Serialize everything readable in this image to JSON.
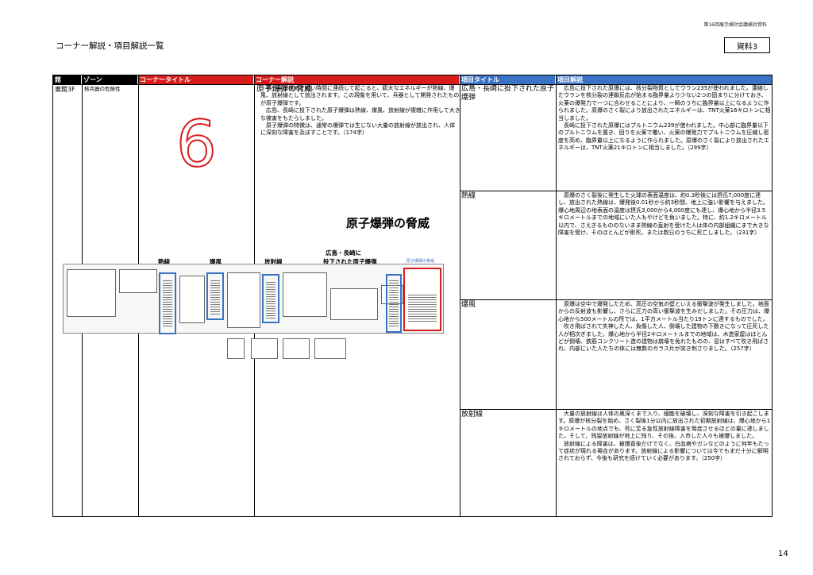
{
  "header": {
    "note": "第16回展示検討会議検討資料",
    "title": "コーナー解説・項目解説一覧",
    "badge": "資料3",
    "page_number": "14"
  },
  "colors": {
    "black": "#000000",
    "red": "#d81b1b",
    "blue": "#3a72c4"
  },
  "columns": [
    "館",
    "ゾーン",
    "コーナータイトル",
    "コーナー解説",
    "項目タイトル",
    "項目解説"
  ],
  "row": {
    "building": "東館3F",
    "zone": "核兵器の危険性",
    "corner_title": "原子爆弾の脅威",
    "corner_number": "6",
    "corner_text": "　核分裂が極めて短い時間に連続して起こると、膨大なエネルギーが熱線、爆風、放射線として放出されます。この現象を用いて、兵器として開発されたものが原子爆弾です。\n　広島、長崎に投下された原子爆弾は熱線、爆風、放射線が複雑に作用して大きな被害をもたらしました。\n　原子爆弾の特徴は、通常の爆弾では生じない大量の放射線が放出され、人体に深刻な障害を及ぼすことです。（174字）"
  },
  "items": [
    {
      "title": "広島・長崎に投下された原子爆弾",
      "text": "　広島に投下された原爆には、核分裂物質としてウラン235が使われました。濃縮したウランを核分裂の連鎖反応が始まる臨界量より少ない2つの固まりに分けておき、火薬の爆発力で一つに合わせることにより、一瞬のうちに臨界量以上になるように作られました。原爆のさく裂により放出されたエネルギーは、TNT火薬16キロトンに相当しました。\n　長崎に投下された原爆にはプルトニウム239が使われました。中心部に臨界量以下のプルトニウムを置き、回りを火薬で覆い、火薬の爆発力でプルトニウムを圧縮し密度を高め、臨界量以上になるように作られました。原爆のさく裂により放出されたエネルギーは、TNT火薬21キロトンに相当しました。（299字）"
    },
    {
      "title": "熱線",
      "text": "　原爆のさく裂後に発生した火球の表面温度は、約0.3秒後には摂氏7,000度に達し、放出された熱線は、爆発後0.01秒から約3秒間、地上に強い影響を与えました。爆心地周辺の地表面の温度は摂氏3,000から4,000度にも達し、爆心地から半径3.5キロメートルまでの地域にいた人もやけどを負いました。特に、約1.2キロメートル以内で、さえぎるもののないまま熱線の直射を受けた人は体の内部組織にまで大きな障害を受け、そのほとんどが即死、または数日のうちに死亡しました。（231字）"
    },
    {
      "title": "爆風",
      "text": "　原爆は空中で爆発したため、高圧の空気の壁といえる衝撃波が発生しました。地面からの反射波も影響し、さらに圧力の高い衝撃波を生みだしました。その圧力は、爆心地から500メートルの所では、1平方メートル当たり19トンに達するものでした。\n　吹き飛ばされて失神した人、負傷した人、倒壊した建物の下敷きになって圧死した人が相次ぎました。爆心地から半径2キロメートルまでの地域は、木造家屋はほとんどが倒壊、鉄筋コンクリート造の建物は崩壊を免れたものの、窓はすべて吹き飛ばされ、内部にいた人たちの体には無数のガラス片が突き刺さりました。（257字）"
    },
    {
      "title": "放射線",
      "text": "　大量の放射線は人体の奥深くまで入り、細胞を破壊し、深刻な障害を引き起こします。原爆が核分裂を始め、さく裂後1分以内に放出された初期放射線は、爆心地から1キロメートルの地点でも、死に至る急性放射線障害を発症させるほどの量に達しました。そして、残留放射線が地上に残り、その後、入市した人々も被爆しました。\n　放射線による障害は、被爆直後だけでなく、白血病やガンなどのように何年もたって症状が現れる場合があります。放射線による影響については今でもまだ十分に解明されておらず、今後も研究を続けていく必要があります。（250字）"
    }
  ],
  "floorplan": {
    "title": "原子爆弾の脅威",
    "labels": {
      "netsusen": "熱線",
      "bakufu": "爆風",
      "houshasen": "放射線",
      "hiroshima_line1": "広島・長崎に",
      "hiroshima_line2": "投下された原子爆弾",
      "corner": "原子爆弾の脅威"
    }
  }
}
